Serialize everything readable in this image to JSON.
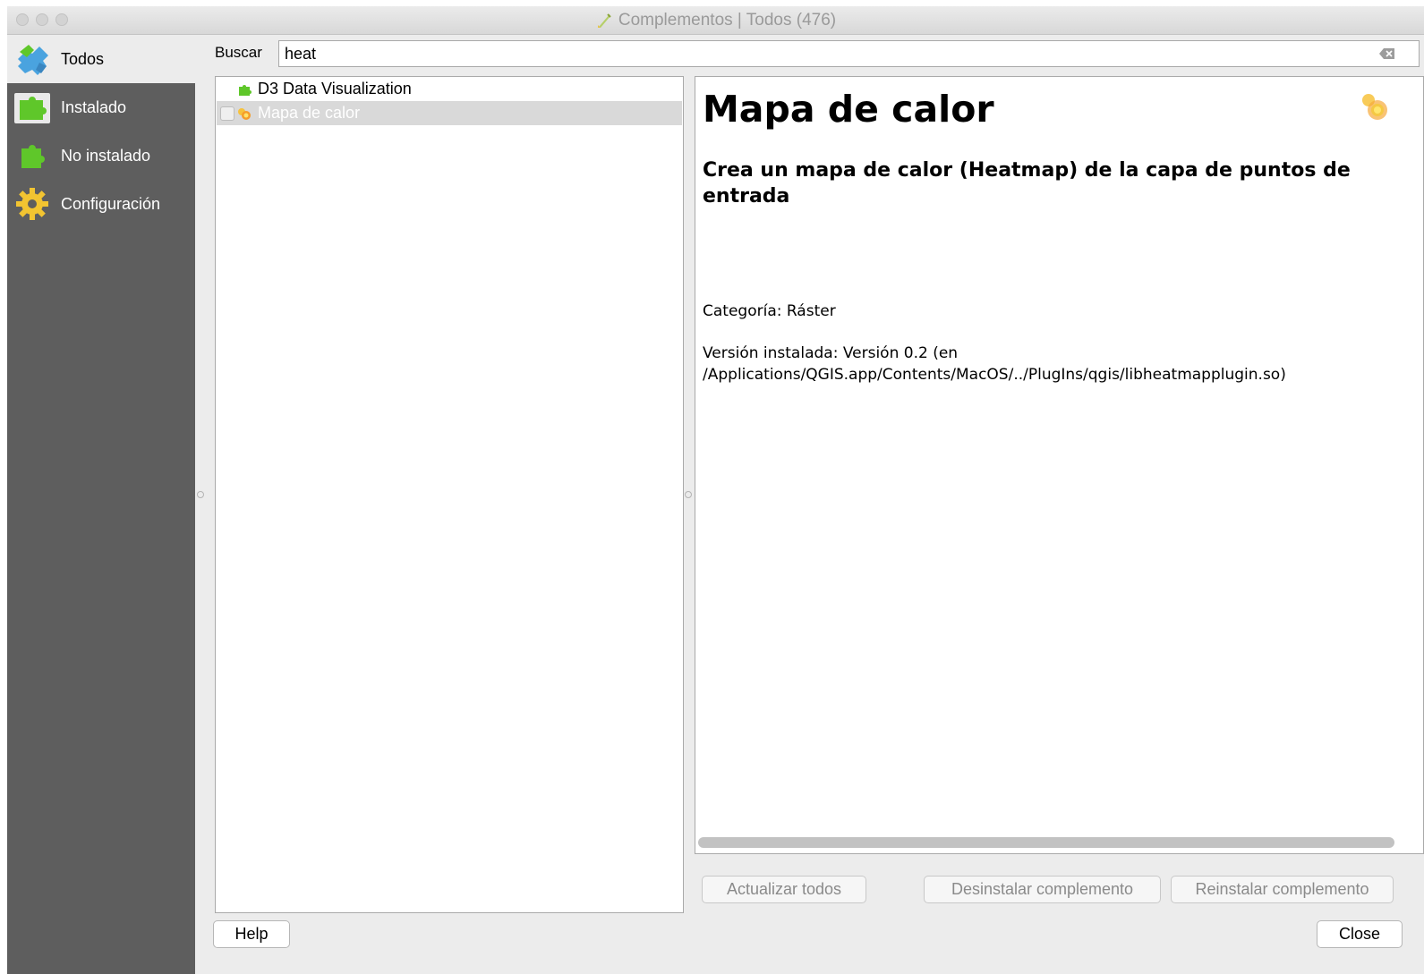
{
  "window": {
    "title": "Complementos | Todos (476)"
  },
  "sidebar": {
    "items": [
      {
        "label": "Todos",
        "icon": "puzzle-all-icon",
        "active": true
      },
      {
        "label": "Instalado",
        "icon": "puzzle-installed-icon",
        "active": false
      },
      {
        "label": "No instalado",
        "icon": "puzzle-not-installed-icon",
        "active": false
      },
      {
        "label": "Configuración",
        "icon": "gear-icon",
        "active": false
      }
    ]
  },
  "search": {
    "label": "Buscar",
    "value": "heat"
  },
  "plugin_list": [
    {
      "name": "D3 Data Visualization",
      "icon": "puzzle-icon",
      "selected": false
    },
    {
      "name": "Mapa de calor",
      "icon": "heatmap-icon",
      "selected": true,
      "checked": true
    }
  ],
  "details": {
    "title": "Mapa de calor",
    "subtitle": "Crea un mapa de calor (Heatmap) de la capa de puntos de entrada",
    "category": "Categoría: Ráster",
    "version_line1": "Versión instalada: Versión 0.2 (en",
    "version_line2": "/Applications/QGIS.app/Contents/MacOS/../PlugIns/qgis/libheatmapplugin.so)"
  },
  "buttons": {
    "upgrade_all": "Actualizar todos",
    "uninstall": "Desinstalar complemento",
    "reinstall": "Reinstalar complemento",
    "help": "Help",
    "close": "Close"
  },
  "colors": {
    "sidebar_bg": "#5e5e5e",
    "puzzle_green": "#5fc72a",
    "puzzle_blue": "#4aa3df",
    "heatmap_orange": "#f7c23c"
  }
}
